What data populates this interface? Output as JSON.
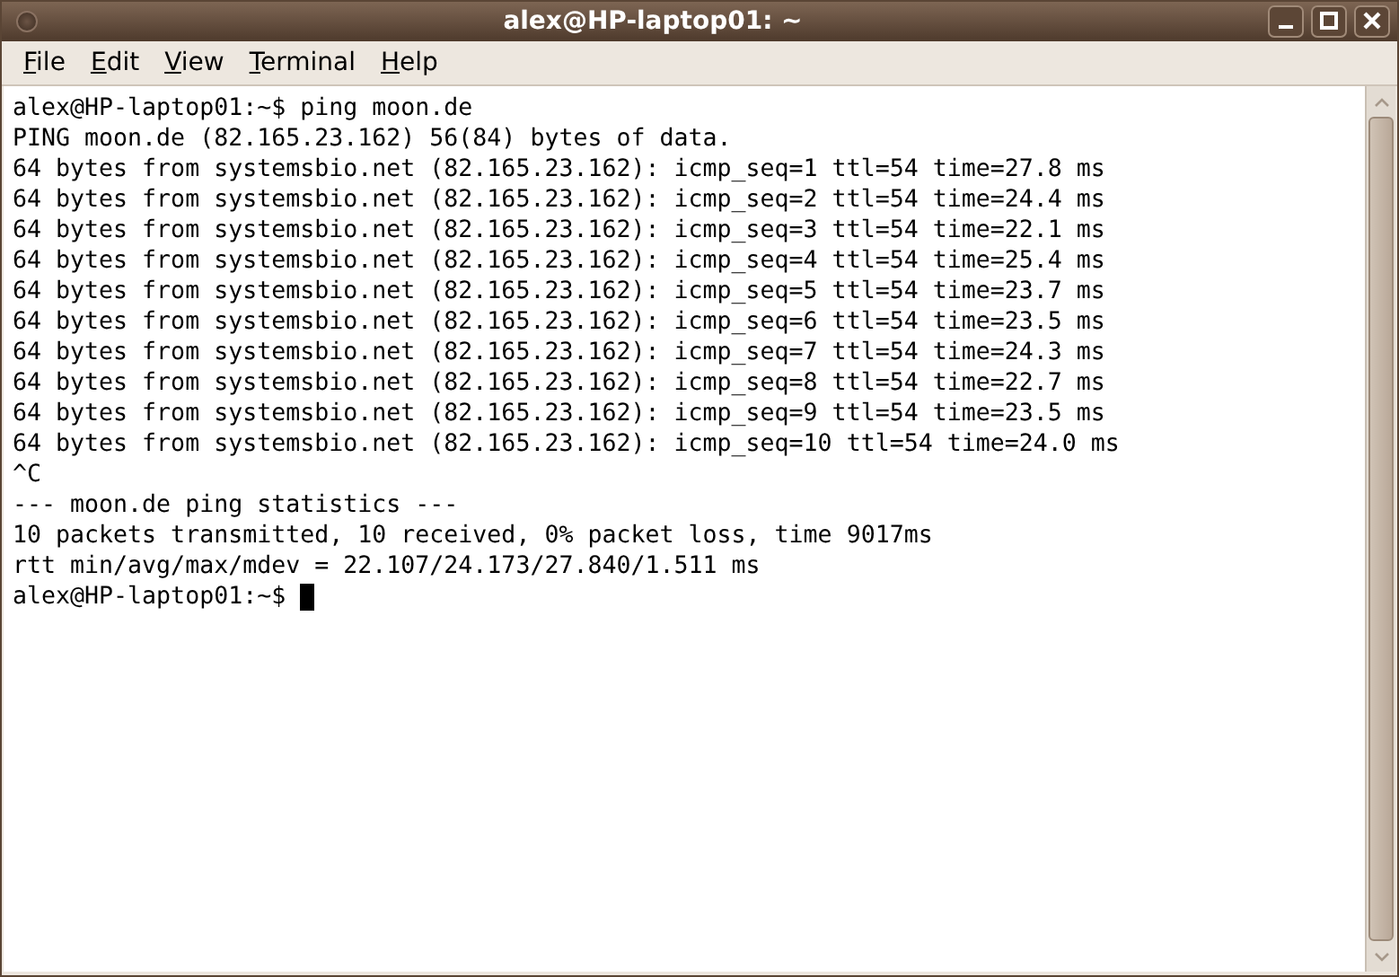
{
  "window": {
    "title": "alex@HP-laptop01: ~"
  },
  "menu": [
    {
      "label": "File"
    },
    {
      "label": "Edit"
    },
    {
      "label": "View"
    },
    {
      "label": "Terminal"
    },
    {
      "label": "Help"
    }
  ],
  "terminal": {
    "lines": [
      "alex@HP-laptop01:~$ ping moon.de",
      "PING moon.de (82.165.23.162) 56(84) bytes of data.",
      "64 bytes from systemsbio.net (82.165.23.162): icmp_seq=1 ttl=54 time=27.8 ms",
      "64 bytes from systemsbio.net (82.165.23.162): icmp_seq=2 ttl=54 time=24.4 ms",
      "64 bytes from systemsbio.net (82.165.23.162): icmp_seq=3 ttl=54 time=22.1 ms",
      "64 bytes from systemsbio.net (82.165.23.162): icmp_seq=4 ttl=54 time=25.4 ms",
      "64 bytes from systemsbio.net (82.165.23.162): icmp_seq=5 ttl=54 time=23.7 ms",
      "64 bytes from systemsbio.net (82.165.23.162): icmp_seq=6 ttl=54 time=23.5 ms",
      "64 bytes from systemsbio.net (82.165.23.162): icmp_seq=7 ttl=54 time=24.3 ms",
      "64 bytes from systemsbio.net (82.165.23.162): icmp_seq=8 ttl=54 time=22.7 ms",
      "64 bytes from systemsbio.net (82.165.23.162): icmp_seq=9 ttl=54 time=23.5 ms",
      "64 bytes from systemsbio.net (82.165.23.162): icmp_seq=10 ttl=54 time=24.0 ms",
      "^C",
      "--- moon.de ping statistics ---",
      "10 packets transmitted, 10 received, 0% packet loss, time 9017ms",
      "rtt min/avg/max/mdev = 22.107/24.173/27.840/1.511 ms"
    ],
    "prompt": "alex@HP-laptop01:~$",
    "cursor_visible": true
  }
}
